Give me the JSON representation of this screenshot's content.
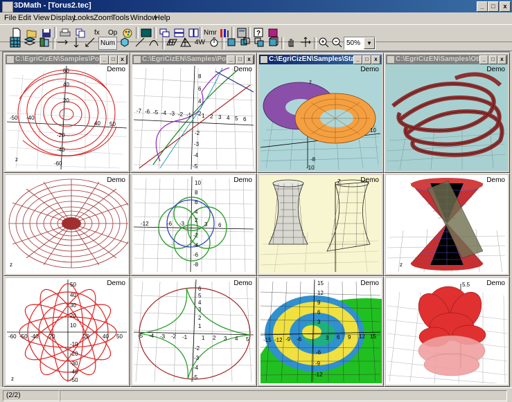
{
  "app": {
    "title": "3DMath - [Torus2.tec]"
  },
  "window_buttons": {
    "minimize": "_",
    "maximize": "□",
    "close": "x"
  },
  "menu": [
    "File",
    "Edit",
    "View",
    "Display",
    "Looks",
    "Zoom",
    "Tools",
    "Window",
    "Help"
  ],
  "toolbar": {
    "fx": "fx",
    "op": "Op",
    "nmr": "Nmr",
    "num": "Num",
    "fourw": "4W",
    "zoom_value": "50%"
  },
  "panels": [
    {
      "title": "C:\\EgriCizEN\\Samples\\Polar...",
      "active": false,
      "demo": "Demo"
    },
    {
      "title": "C:\\EgriCizEN\\Samples\\Polar...",
      "active": false,
      "demo": "Demo"
    },
    {
      "title": "C:\\EgriCizEN\\Samples\\Stage...",
      "active": true,
      "demo": "Demo"
    },
    {
      "title": "C:\\EgriCizEN\\Samples\\Other...",
      "active": false,
      "demo": "Demo"
    },
    {
      "title": "",
      "active": false,
      "demo": "Demo"
    },
    {
      "title": "",
      "active": false,
      "demo": "Demo"
    },
    {
      "title": "",
      "active": false,
      "demo": "Demo"
    },
    {
      "title": "",
      "active": false,
      "demo": "Demo"
    },
    {
      "title": "",
      "active": false,
      "demo": "Demo"
    },
    {
      "title": "",
      "active": false,
      "demo": "Demo"
    },
    {
      "title": "",
      "active": false,
      "demo": "Demo"
    },
    {
      "title": "",
      "active": false,
      "demo": "Demo"
    }
  ],
  "graph_labels": {
    "p1": [
      "60",
      "40",
      "20",
      "-40",
      "40",
      "-20",
      "-40",
      "-60",
      "50",
      "-50",
      "z"
    ],
    "p2": [
      "8",
      "6",
      "4",
      "2",
      "-7",
      "-6",
      "-5",
      "-4",
      "-3",
      "-2",
      "-1",
      "1",
      "2",
      "3",
      "4",
      "5",
      "6",
      "-2",
      "-3",
      "-4",
      "-5"
    ],
    "p3": [
      "10",
      "-8",
      "-10",
      "z"
    ],
    "p6": [
      "10",
      "8",
      "6",
      "4",
      "2",
      "-12",
      "-6",
      "-3",
      "3",
      "6",
      "-2",
      "-4",
      "-6",
      "-8"
    ],
    "p9": [
      "50",
      "40",
      "30",
      "20",
      "10",
      "-60",
      "-50",
      "-40",
      "-20",
      "20",
      "40",
      "50",
      "-10",
      "-20",
      "-30",
      "-40",
      "-50",
      "z"
    ],
    "p10": [
      "6",
      "5",
      "4",
      "3",
      "2",
      "1",
      "-5",
      "-4",
      "-3",
      "-2",
      "-1",
      "1",
      "2",
      "3",
      "4",
      "5",
      "-2",
      "-3",
      "-4",
      "-5"
    ],
    "p11": [
      "15",
      "12",
      "9",
      "6",
      "3",
      "-15",
      "-12",
      "-9",
      "-6",
      "3",
      "6",
      "9",
      "12",
      "15",
      "-6",
      "-9",
      "-12"
    ],
    "p12": [
      "5.5"
    ]
  },
  "status": {
    "page": "(2/2)"
  },
  "colors": {
    "title_active": "#0a246a",
    "mdi_bg": "#808080",
    "panel3_bg": "#aed6d8",
    "panel7_bg": "#f8f6d0"
  }
}
